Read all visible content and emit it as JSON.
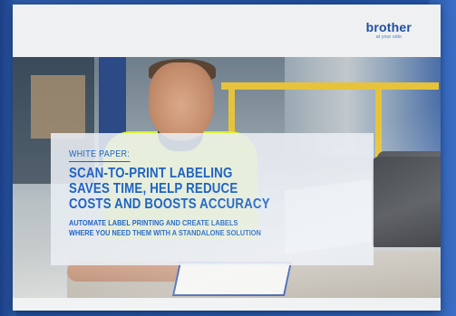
{
  "brand": {
    "name": "brother",
    "tagline": "at your side"
  },
  "document": {
    "eyebrow": "WHITE PAPER:",
    "title_lines": [
      "SCAN-TO-PRINT LABELING",
      "SAVES TIME, HELP REDUCE",
      "COSTS AND BOOSTS ACCURACY"
    ],
    "subtitle_lines": [
      "AUTOMATE LABEL PRINTING AND CREATE LABELS",
      "WHERE YOU NEED THEM WITH A STANDALONE SOLUTION"
    ]
  },
  "colors": {
    "accent": "#1e63c4",
    "brand": "#1f4fa0",
    "background": "#2a5aa8"
  }
}
